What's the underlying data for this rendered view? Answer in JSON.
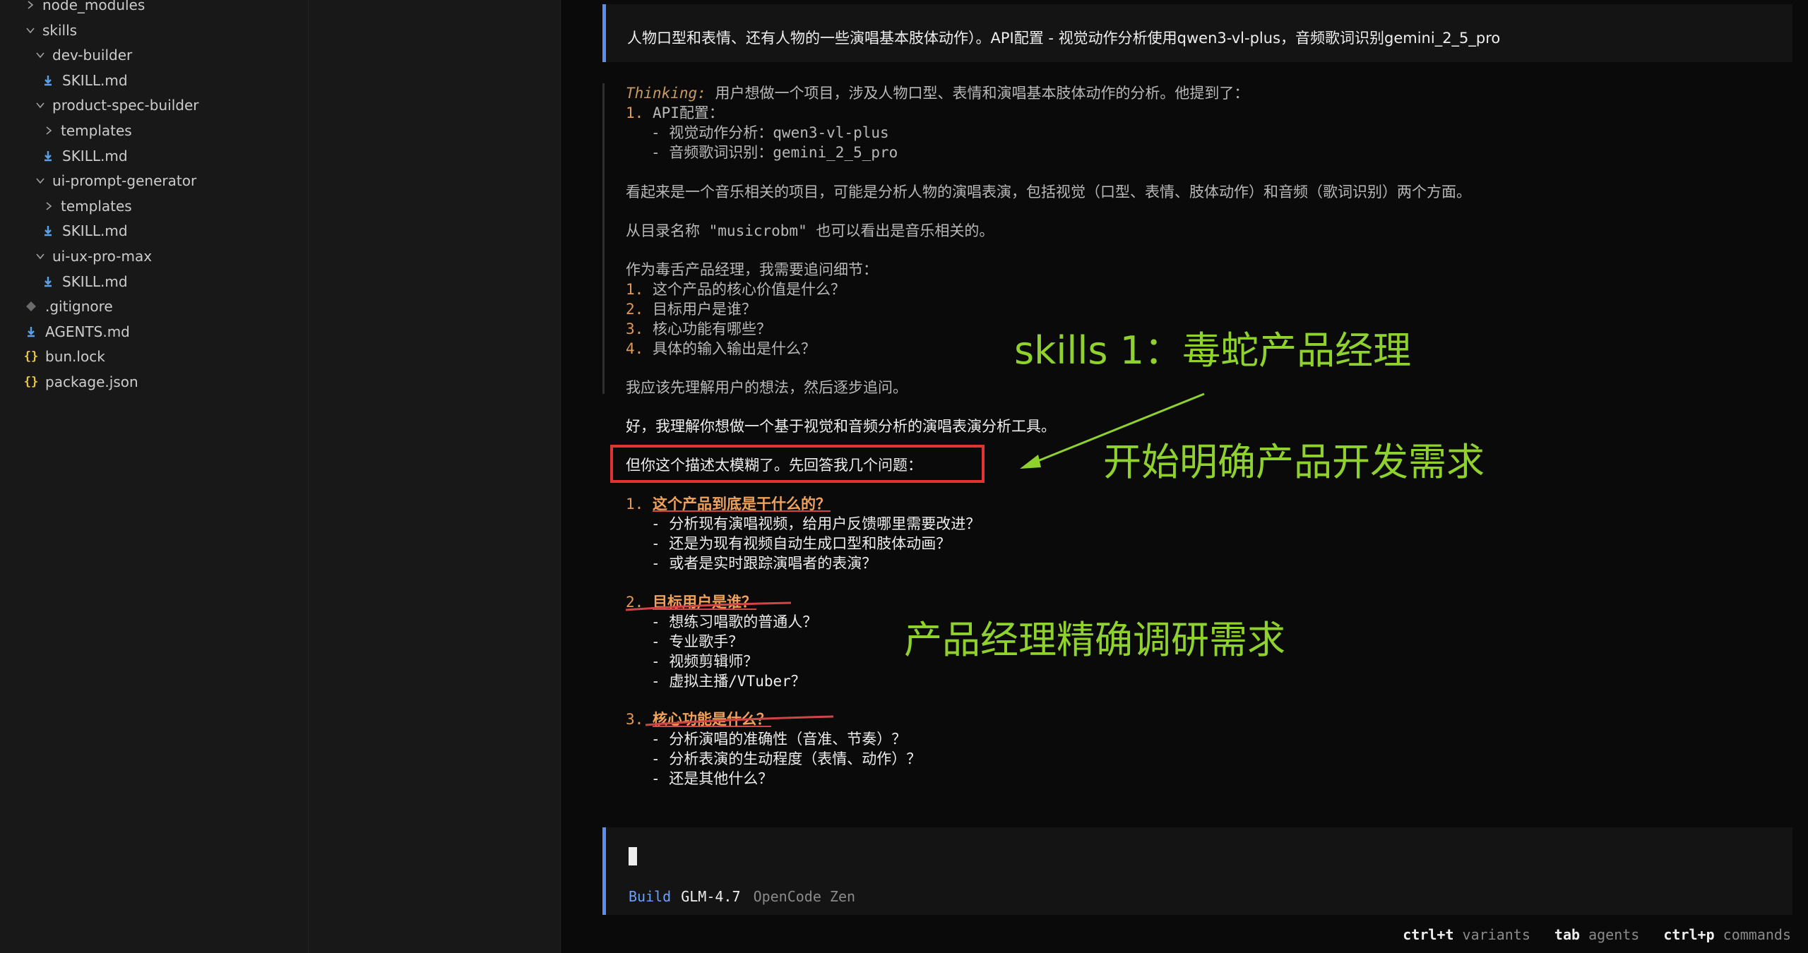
{
  "sidebar": {
    "items": [
      {
        "label": "node_modules",
        "kind": "folder",
        "open": false,
        "depth": 1
      },
      {
        "label": "skills",
        "kind": "folder",
        "open": true,
        "depth": 1
      },
      {
        "label": "dev-builder",
        "kind": "folder",
        "open": true,
        "depth": 2
      },
      {
        "label": "SKILL.md",
        "kind": "md",
        "depth": 3
      },
      {
        "label": "product-spec-builder",
        "kind": "folder",
        "open": true,
        "depth": 2
      },
      {
        "label": "templates",
        "kind": "folder",
        "open": false,
        "depth": 3
      },
      {
        "label": "SKILL.md",
        "kind": "md",
        "depth": 3
      },
      {
        "label": "ui-prompt-generator",
        "kind": "folder",
        "open": true,
        "depth": 2
      },
      {
        "label": "templates",
        "kind": "folder",
        "open": false,
        "depth": 3
      },
      {
        "label": "SKILL.md",
        "kind": "md",
        "depth": 3
      },
      {
        "label": "ui-ux-pro-max",
        "kind": "folder",
        "open": true,
        "depth": 2
      },
      {
        "label": "SKILL.md",
        "kind": "md",
        "depth": 3
      },
      {
        "label": ".gitignore",
        "kind": "git",
        "depth": 1
      },
      {
        "label": "AGENTS.md",
        "kind": "md",
        "depth": 1
      },
      {
        "label": "bun.lock",
        "kind": "json",
        "depth": 1
      },
      {
        "label": "package.json",
        "kind": "json",
        "depth": 1
      }
    ]
  },
  "user_message": "人物口型和表情、还有人物的一些演唱基本肢体动作）。API配置 - 视觉动作分析使用qwen3-vl-plus，音频歌词识别gemini_2_5_pro",
  "thinking": {
    "label": "Thinking:",
    "intro": " 用户想做一个项目，涉及人物口型、表情和演唱基本肢体动作的分析。他提到了：",
    "api_num": "1.",
    "api_title": " API配置：",
    "api_items": [
      "- 视觉动作分析：qwen3-vl-plus",
      "- 音频歌词识别：gemini_2_5_pro"
    ],
    "para1": "看起来是一个音乐相关的项目，可能是分析人物的演唱表演，包括视觉（口型、表情、肢体动作）和音频（歌词识别）两个方面。",
    "para2": "从目录名称 \"musicrobm\" 也可以看出是音乐相关的。",
    "para3": "作为毒舌产品经理，我需要追问细节：",
    "questions": [
      {
        "num": "1.",
        "text": " 这个产品的核心价值是什么？"
      },
      {
        "num": "2.",
        "text": " 目标用户是谁？"
      },
      {
        "num": "3.",
        "text": " 核心功能有哪些？"
      },
      {
        "num": "4.",
        "text": " 具体的输入输出是什么？"
      }
    ],
    "para4": "我应该先理解用户的想法，然后逐步追问。"
  },
  "response": {
    "line1": "好，我理解你想做一个基于视觉和音频分析的演唱表演分析工具。",
    "line2": "但你这个描述太模糊了。先回答我几个问题：",
    "sections": [
      {
        "num": "1.",
        "title": "这个产品到底是干什么的？",
        "items": [
          "- 分析现有演唱视频，给用户反馈哪里需要改进？",
          "- 还是为现有视频自动生成口型和肢体动画？",
          "- 或者是实时跟踪演唱者的表演？"
        ]
      },
      {
        "num": "2.",
        "title": "目标用户是谁？",
        "items": [
          "- 想练习唱歌的普通人？",
          "- 专业歌手？",
          "- 视频剪辑师？",
          "- 虚拟主播/VTuber？"
        ]
      },
      {
        "num": "3.",
        "title": "核心功能是什么？",
        "items": [
          "- 分析演唱的准确性（音准、节奏）？",
          "- 分析表演的生动程度（表情、动作）？",
          "- 还是其他什么？"
        ]
      }
    ]
  },
  "annotations": {
    "a1": "skills 1：毒蛇产品经理",
    "a2": "开始明确产品开发需求",
    "a3": "产品经理精确调研需求",
    "color": "#8fd12d"
  },
  "input": {
    "mode": "Build",
    "model": "GLM-4.7",
    "provider": "OpenCode Zen"
  },
  "shortcuts": [
    {
      "key": "ctrl+t",
      "desc": "variants"
    },
    {
      "key": "tab",
      "desc": "agents"
    },
    {
      "key": "ctrl+p",
      "desc": "commands"
    }
  ],
  "colors": {
    "accent": "#5b8def",
    "mode": "#6aa0ff",
    "orange": "#f0a15a",
    "red_box": "#e03333"
  }
}
